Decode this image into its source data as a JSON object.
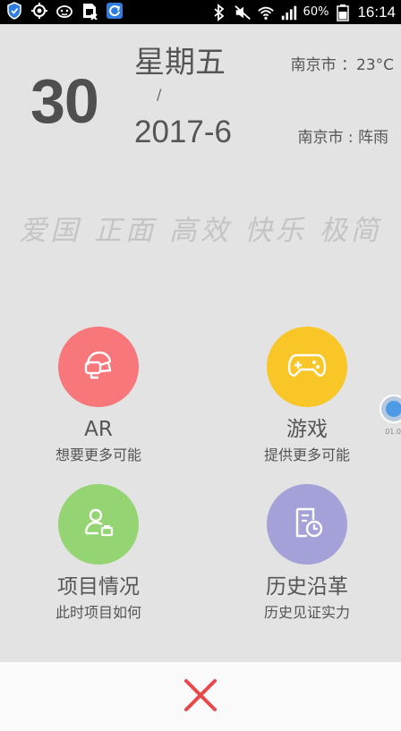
{
  "status_bar": {
    "battery": "60%",
    "time": "16:14",
    "left_icons": [
      "shield-icon",
      "location-icon",
      "face-icon",
      "sim-icon",
      "refresh-icon"
    ],
    "right_icons": [
      "bluetooth-icon",
      "mute-icon",
      "wifi-icon",
      "signal-icon",
      "battery-icon"
    ]
  },
  "header": {
    "day": "30",
    "weekday": "星期五",
    "separator": "/",
    "year_month": "2017-6",
    "temperature": "南京市 ：23°C",
    "condition": "南京市 : 阵雨"
  },
  "slogan": "爱国 正面 高效 快乐 极简",
  "menu": {
    "items": [
      {
        "title": "AR",
        "subtitle": "想要更多可能",
        "icon": "ar-headset-icon",
        "color": "#f7777b"
      },
      {
        "title": "游戏",
        "subtitle": "提供更多可能",
        "icon": "gamepad-icon",
        "color": "#f9c628"
      },
      {
        "title": "项目情况",
        "subtitle": "此时项目如何",
        "icon": "user-card-icon",
        "color": "#94d472"
      },
      {
        "title": "历史沿革",
        "subtitle": "历史见证实力",
        "icon": "history-document-icon",
        "color": "#a3a1d8"
      }
    ]
  },
  "side_widget_label": "01.0",
  "close_icon": "close-icon",
  "colors": {
    "background": "#e3e3e3",
    "close": "#e8474b"
  }
}
